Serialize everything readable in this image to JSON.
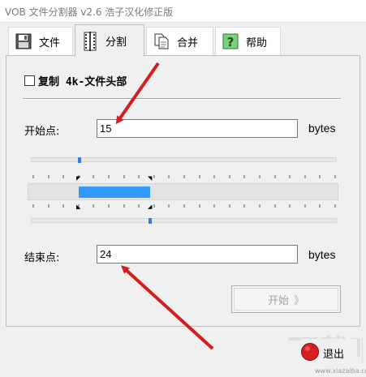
{
  "window": {
    "title": "VOB 文件分割器 v2.6 浩子汉化修正版"
  },
  "tabs": [
    {
      "label": "文件",
      "icon": "floppy-disk-icon",
      "active": false
    },
    {
      "label": "分割",
      "icon": "film-split-icon",
      "active": true
    },
    {
      "label": "合并",
      "icon": "documents-icon",
      "active": false
    },
    {
      "label": "帮助",
      "icon": "question-icon",
      "active": false
    }
  ],
  "split": {
    "copy_header_label": "复制 4k-文件头部",
    "copy_header_checked": false,
    "start_label": "开始点:",
    "start_value": "15",
    "start_unit": "bytes",
    "end_label": "结束点:",
    "end_value": "24",
    "end_unit": "bytes",
    "start_slider_fraction": 0.16,
    "end_slider_fraction": 0.39,
    "start_button_label": "开始",
    "start_button_chevron": "》",
    "start_button_enabled": false
  },
  "footer": {
    "exit_label": "退出"
  },
  "watermark": {
    "site": "www.xiazaiba.com"
  },
  "colors": {
    "accent": "#3399ff",
    "arrow": "#d11f1f",
    "thumb": "#2f7fe0"
  }
}
